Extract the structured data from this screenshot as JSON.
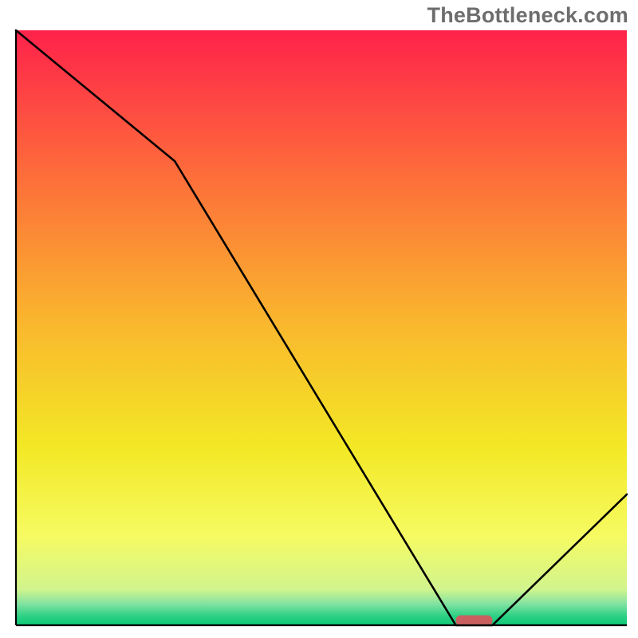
{
  "watermark": "TheBottleneck.com",
  "chart_data": {
    "type": "line",
    "title": "",
    "xlabel": "",
    "ylabel": "",
    "xlim": [
      0,
      100
    ],
    "ylim": [
      0,
      100
    ],
    "grid": false,
    "legend": null,
    "series": [
      {
        "name": "curve",
        "x": [
          0,
          26,
          72,
          78,
          100
        ],
        "values": [
          100,
          78,
          0,
          0,
          22
        ]
      }
    ],
    "marker": {
      "name": "marker-pill",
      "x_center": 75,
      "y": 0.8,
      "width_x_units": 6,
      "color": "#c9605f"
    },
    "axes": {
      "left_line": true,
      "bottom_line": true,
      "right_line": false,
      "top_line": false,
      "line_color": "#000000",
      "line_width": 2.2
    },
    "background_gradient": {
      "stops": [
        {
          "offset": 0.0,
          "color": "#ff224b"
        },
        {
          "offset": 0.25,
          "color": "#fd6f3a"
        },
        {
          "offset": 0.5,
          "color": "#f9b92d"
        },
        {
          "offset": 0.7,
          "color": "#f3e825"
        },
        {
          "offset": 0.85,
          "color": "#f6fb62"
        },
        {
          "offset": 0.94,
          "color": "#d1f48e"
        },
        {
          "offset": 0.965,
          "color": "#7ee2a1"
        },
        {
          "offset": 0.985,
          "color": "#2bd084"
        },
        {
          "offset": 1.0,
          "color": "#0fc978"
        }
      ]
    }
  }
}
